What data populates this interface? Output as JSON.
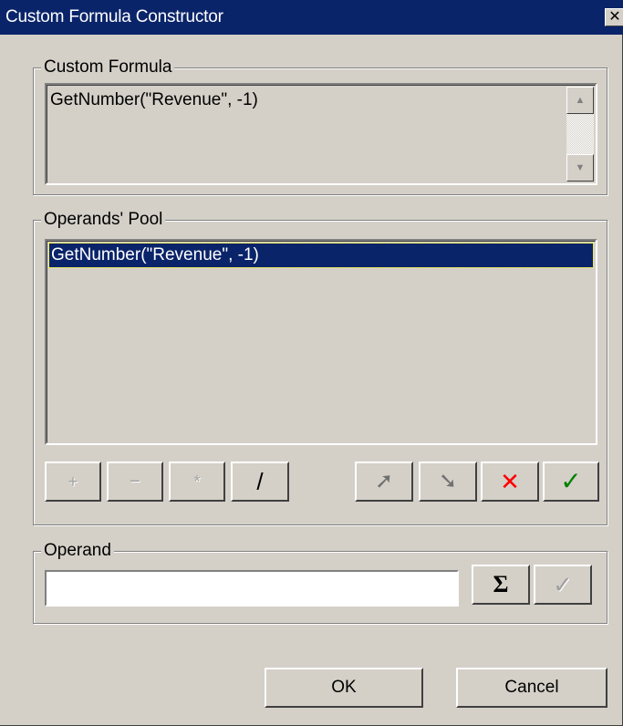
{
  "window": {
    "title": "Custom Formula Constructor",
    "close_glyph": "✕"
  },
  "custom_formula": {
    "legend": "Custom Formula",
    "text": "GetNumber(\"Revenue\", -1)",
    "scroll_up_icon": "▲",
    "scroll_down_icon": "▼"
  },
  "operands_pool": {
    "legend": "Operands' Pool",
    "items": [
      "GetNumber(\"Revenue\", -1)"
    ],
    "selected_index": 0
  },
  "operator_buttons": [
    {
      "label": "+",
      "enabled": false
    },
    {
      "label": "−",
      "enabled": false
    },
    {
      "label": "*",
      "enabled": false
    },
    {
      "label": "/",
      "enabled": true
    }
  ],
  "action_buttons": [
    {
      "icon": "arrow-up-right-icon",
      "glyph": "➚",
      "color": "#808080"
    },
    {
      "icon": "arrow-down-right-icon",
      "glyph": "➘",
      "color": "#808080"
    },
    {
      "icon": "delete-x-icon",
      "glyph": "✕",
      "color": "#ff0000"
    },
    {
      "icon": "accept-check-icon",
      "glyph": "✓",
      "color": "#008000"
    }
  ],
  "operand": {
    "legend": "Operand",
    "value": "",
    "sigma_label": "Σ",
    "check_label": "✓"
  },
  "footer": {
    "ok_label": "OK",
    "cancel_label": "Cancel"
  },
  "colors": {
    "selection": "#0a246a",
    "face": "#d4d0c8",
    "delete": "#ff0000",
    "accept": "#008000"
  }
}
